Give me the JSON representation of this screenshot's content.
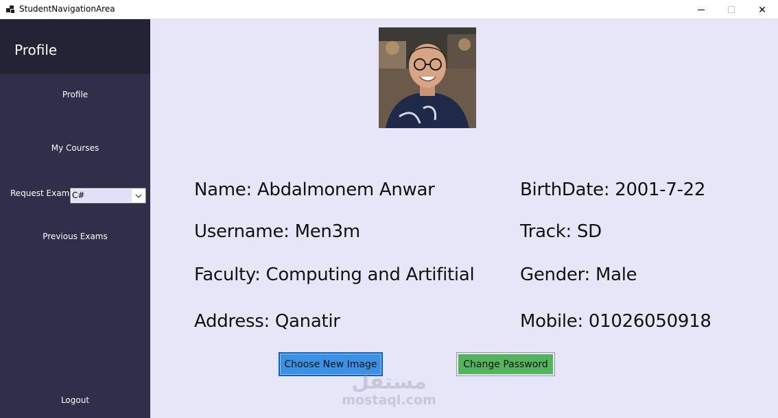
{
  "window": {
    "title": "StudentNavigationArea",
    "close_symbol": "✕"
  },
  "sidebar": {
    "header_title": "Profile",
    "items": {
      "profile": "Profile",
      "my_courses": "My Courses",
      "request_exam_label": "Request Exam",
      "previous_exams": "Previous Exams",
      "logout": "Logout"
    },
    "exam_select": {
      "selected": "C#"
    }
  },
  "profile": {
    "name_line": "Name: Abdalmonem Anwar",
    "username_line": "Username: Men3m",
    "faculty_line": "Faculty: Computing and Artifitial",
    "address_line": "Address: Qanatir",
    "birthdate_line": "BirthDate: 2001-7-22",
    "track_line": "Track: SD",
    "gender_line": "Gender: Male",
    "mobile_line": "Mobile: 01026050918"
  },
  "buttons": {
    "choose_image": "Choose New Image",
    "change_password": "Change Password"
  },
  "watermark": {
    "logo": "مستقل",
    "text": "mostaql.com"
  },
  "colors": {
    "sidebar": "#2f2f4b",
    "sidebar_header": "#232336",
    "main_bg": "#e6e6f8",
    "choose_image_button": "#3b92e4",
    "change_password_button": "#54b45d"
  }
}
